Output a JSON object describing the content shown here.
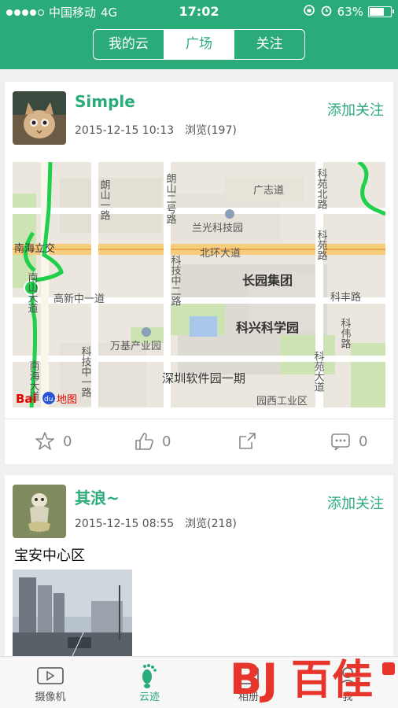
{
  "status": {
    "carrier": "中国移动",
    "network": "4G",
    "time": "17:02",
    "battery": "63%",
    "battery_level": 0.63
  },
  "segments": [
    {
      "label": "我的云",
      "active": false
    },
    {
      "label": "广场",
      "active": true
    },
    {
      "label": "关注",
      "active": false
    }
  ],
  "posts": [
    {
      "username": "Simple",
      "date": "2015-12-15 10:13",
      "views": "浏览(197)",
      "follow_label": "添加关注",
      "map": {
        "labels": {
          "langshan1": "朗山一路",
          "langshan2": "朗山二号路",
          "guangzhi": "广志道",
          "keyuanbei": "科苑北路",
          "lanGuang": "兰光科技园",
          "nanhai": "南海立交",
          "beihuan": "北环大道",
          "keyuan": "科苑路",
          "nanshan": "南山大道",
          "gaoxin": "高新中一道",
          "keji2": "科技中二路",
          "changyuan": "长园集团",
          "kefeng": "科丰路",
          "kexing": "科兴科学园",
          "kewei": "科伟路",
          "wanji": "万基产业园",
          "kejizhong1": "科技中一路",
          "nanhaida": "南海大道",
          "ruanjian": "深圳软件园一期",
          "kedaodao": "科苑大道",
          "yuanxi": "园西工业区",
          "baidu_map": "地图"
        }
      },
      "actions": {
        "favorite": "0",
        "like": "0",
        "share": "",
        "comment": "0"
      }
    },
    {
      "username": "其浪~",
      "date": "2015-12-15 08:55",
      "views": "浏览(218)",
      "follow_label": "添加关注",
      "caption": "宝安中心区"
    }
  ],
  "tabbar": [
    {
      "label": "摄像机",
      "icon": "video-camera-icon",
      "active": false
    },
    {
      "label": "云迹",
      "icon": "footprint-icon",
      "active": true
    },
    {
      "label": "相册",
      "icon": "album-icon",
      "active": false
    },
    {
      "label": "我",
      "icon": "profile-icon",
      "active": false
    }
  ],
  "watermark": {
    "text": "百佳"
  },
  "colors": {
    "accent": "#2bab7a",
    "background": "#f0f0f3",
    "map_route": "#1ed04a"
  }
}
